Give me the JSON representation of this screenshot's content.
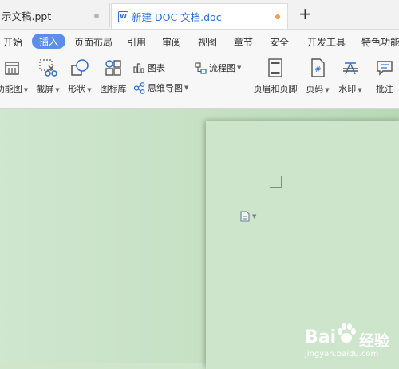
{
  "tabs": [
    {
      "label": "示文稿.ppt"
    },
    {
      "label": "新建 DOC 文档.doc",
      "icon_letter": "W"
    }
  ],
  "new_tab_label": "+",
  "menu": {
    "items": [
      "开始",
      "插入",
      "页面布局",
      "引用",
      "审阅",
      "视图",
      "章节",
      "安全",
      "开发工具",
      "特色功能"
    ],
    "active": "插入"
  },
  "ribbon": {
    "func_chart": "功能图",
    "screenshot": "截屏",
    "shapes": "形状",
    "icon_library": "图标库",
    "chart": "图表",
    "mind_map": "思维导图",
    "flowchart": "流程图",
    "header_footer": "页眉和页脚",
    "page_number": "页码",
    "watermark": "水印",
    "comment": "批注"
  },
  "watermark_site": {
    "brand_latin": "Bai",
    "brand_cn": "经验",
    "url": "jingyan.baidu.com"
  },
  "colors": {
    "accent": "#5b8ee8",
    "doc_tab_text": "#2c6cd6",
    "unsaved_dot": "#f0a04b",
    "background": "#cfe6cd"
  }
}
